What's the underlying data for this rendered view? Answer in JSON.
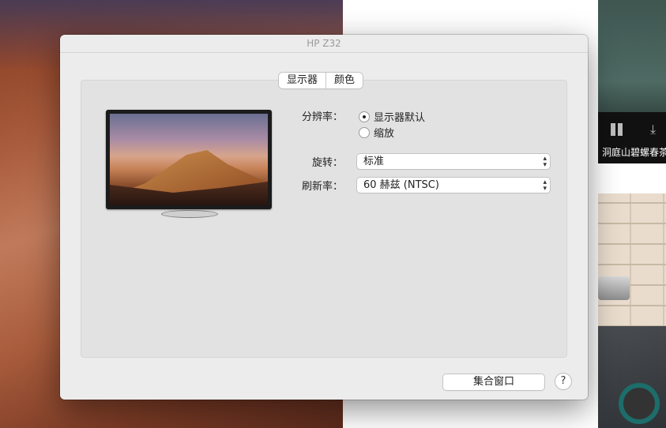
{
  "window": {
    "title": "HP Z32"
  },
  "tabs": [
    {
      "label": "显示器",
      "active": true
    },
    {
      "label": "颜色",
      "active": false
    }
  ],
  "resolution": {
    "label": "分辨率：",
    "options": [
      {
        "label": "显示器默认",
        "selected": true
      },
      {
        "label": "缩放",
        "selected": false
      }
    ]
  },
  "rotation": {
    "label": "旋转：",
    "value": "标准"
  },
  "refresh_rate": {
    "label": "刷新率：",
    "value": "60 赫兹 (NTSC)"
  },
  "buttons": {
    "gather_windows": "集合窗口",
    "help": "?"
  },
  "background_app": {
    "video_title": "洞庭山碧螺春茶"
  }
}
